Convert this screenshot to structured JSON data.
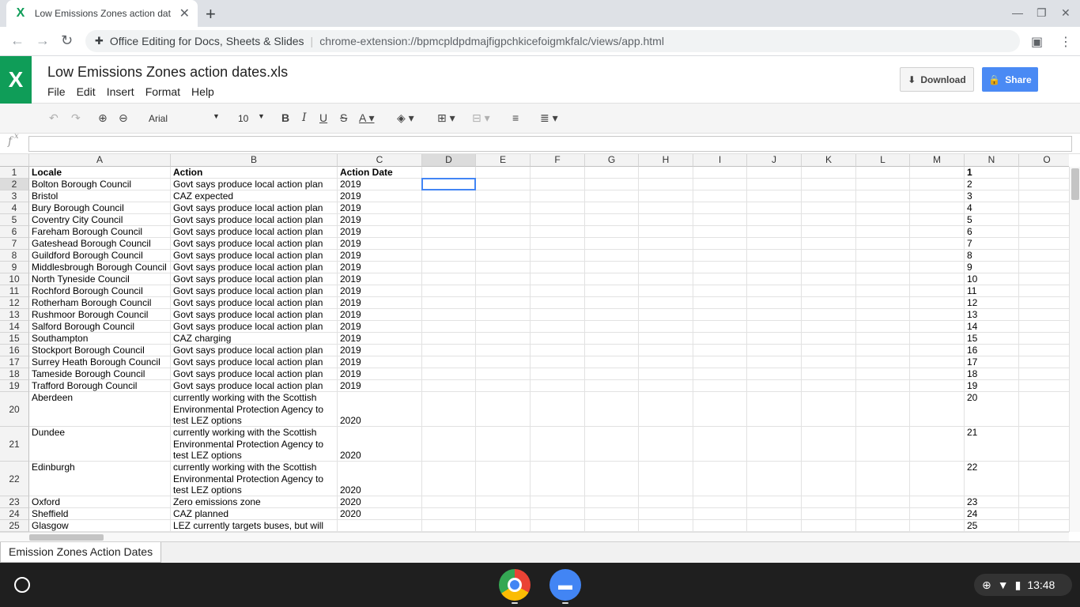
{
  "browser": {
    "tab_title": "Low Emissions Zones action dat",
    "tab_favicon": "X",
    "new_tab_glyph": "+",
    "close_glyph": "✕",
    "extension_name": "Office Editing for Docs, Sheets & Slides",
    "url": "chrome-extension://bpmcpldpdmajfigpchkicefoigmkfalc/views/app.html"
  },
  "app": {
    "logo": "X",
    "doc_title": "Low Emissions Zones action dates.xls",
    "menu": [
      "File",
      "Edit",
      "Insert",
      "Format",
      "Help"
    ],
    "download_label": "Download",
    "share_label": "Share",
    "accent_color": "#0f9d58",
    "share_color": "#4a8af4"
  },
  "format_toolbar": {
    "font": "Arial",
    "font_size": "10"
  },
  "formula_bar": {
    "fx_label": "f",
    "value": ""
  },
  "sheet": {
    "columns": [
      "A",
      "B",
      "C",
      "D",
      "E",
      "F",
      "G",
      "H",
      "I",
      "J",
      "K",
      "L",
      "M",
      "N",
      "O"
    ],
    "selected_column": "D",
    "selected_row": 2,
    "rows": [
      {
        "n": "1",
        "a": "Locale",
        "b": "Action",
        "c": "Action Date"
      },
      {
        "n": "2",
        "a": "Bolton Borough Council",
        "b": "Govt says produce local action plan",
        "c": "2019"
      },
      {
        "n": "3",
        "a": "Bristol",
        "b": "CAZ expected",
        "c": "2019"
      },
      {
        "n": "4",
        "a": "Bury Borough Council",
        "b": "Govt says produce local action plan",
        "c": "2019"
      },
      {
        "n": "5",
        "a": "Coventry City Council",
        "b": "Govt says produce local action plan",
        "c": "2019"
      },
      {
        "n": "6",
        "a": "Fareham Borough Council",
        "b": "Govt says produce local action plan",
        "c": "2019"
      },
      {
        "n": "7",
        "a": "Gateshead Borough Council",
        "b": "Govt says produce local action plan",
        "c": "2019"
      },
      {
        "n": "8",
        "a": "Guildford Borough Council",
        "b": "Govt says produce local action plan",
        "c": "2019"
      },
      {
        "n": "9",
        "a": "Middlesbrough Borough Council",
        "b": "Govt says produce local action plan",
        "c": "2019"
      },
      {
        "n": "10",
        "a": "North Tyneside Council",
        "b": "Govt says produce local action plan",
        "c": "2019"
      },
      {
        "n": "11",
        "a": "Rochford Borough Council",
        "b": "Govt says produce local action plan",
        "c": "2019"
      },
      {
        "n": "12",
        "a": "Rotherham Borough Council",
        "b": "Govt says produce local action plan",
        "c": "2019"
      },
      {
        "n": "13",
        "a": "Rushmoor Borough Council",
        "b": "Govt says produce local action plan",
        "c": "2019"
      },
      {
        "n": "14",
        "a": "Salford Borough Council",
        "b": "Govt says produce local action plan",
        "c": "2019"
      },
      {
        "n": "15",
        "a": "Southampton",
        "b": "CAZ charging",
        "c": "2019"
      },
      {
        "n": "16",
        "a": "Stockport Borough Council",
        "b": "Govt says produce local action plan",
        "c": "2019"
      },
      {
        "n": "17",
        "a": "Surrey Heath Borough Council",
        "b": "Govt says produce local action plan",
        "c": "2019"
      },
      {
        "n": "18",
        "a": "Tameside Borough Council",
        "b": "Govt says produce local action plan",
        "c": "2019"
      },
      {
        "n": "19",
        "a": "Trafford Borough Council",
        "b": "Govt says produce local action plan",
        "c": "2019"
      },
      {
        "n": "20",
        "a": "Aberdeen",
        "b": "currently working with the Scottish Environmental Protection Agency to test LEZ options",
        "c": "2020"
      },
      {
        "n": "21",
        "a": "Dundee",
        "b": "currently working with the Scottish Environmental Protection Agency to test LEZ options",
        "c": "2020"
      },
      {
        "n": "22",
        "a": "Edinburgh",
        "b": "currently working with the Scottish Environmental Protection Agency to test LEZ options",
        "c": "2020"
      },
      {
        "n": "23",
        "a": "Oxford",
        "b": "Zero emissions zone",
        "c": "2020"
      },
      {
        "n": "24",
        "a": "Sheffield",
        "b": "CAZ planned",
        "c": "2020"
      },
      {
        "n": "25",
        "a": "Glasgow",
        "b": "LEZ currently targets buses, but will",
        "c": ""
      }
    ]
  },
  "sheet_tabs": [
    "Emission Zones Action Dates"
  ],
  "shelf": {
    "time": "13:48"
  }
}
